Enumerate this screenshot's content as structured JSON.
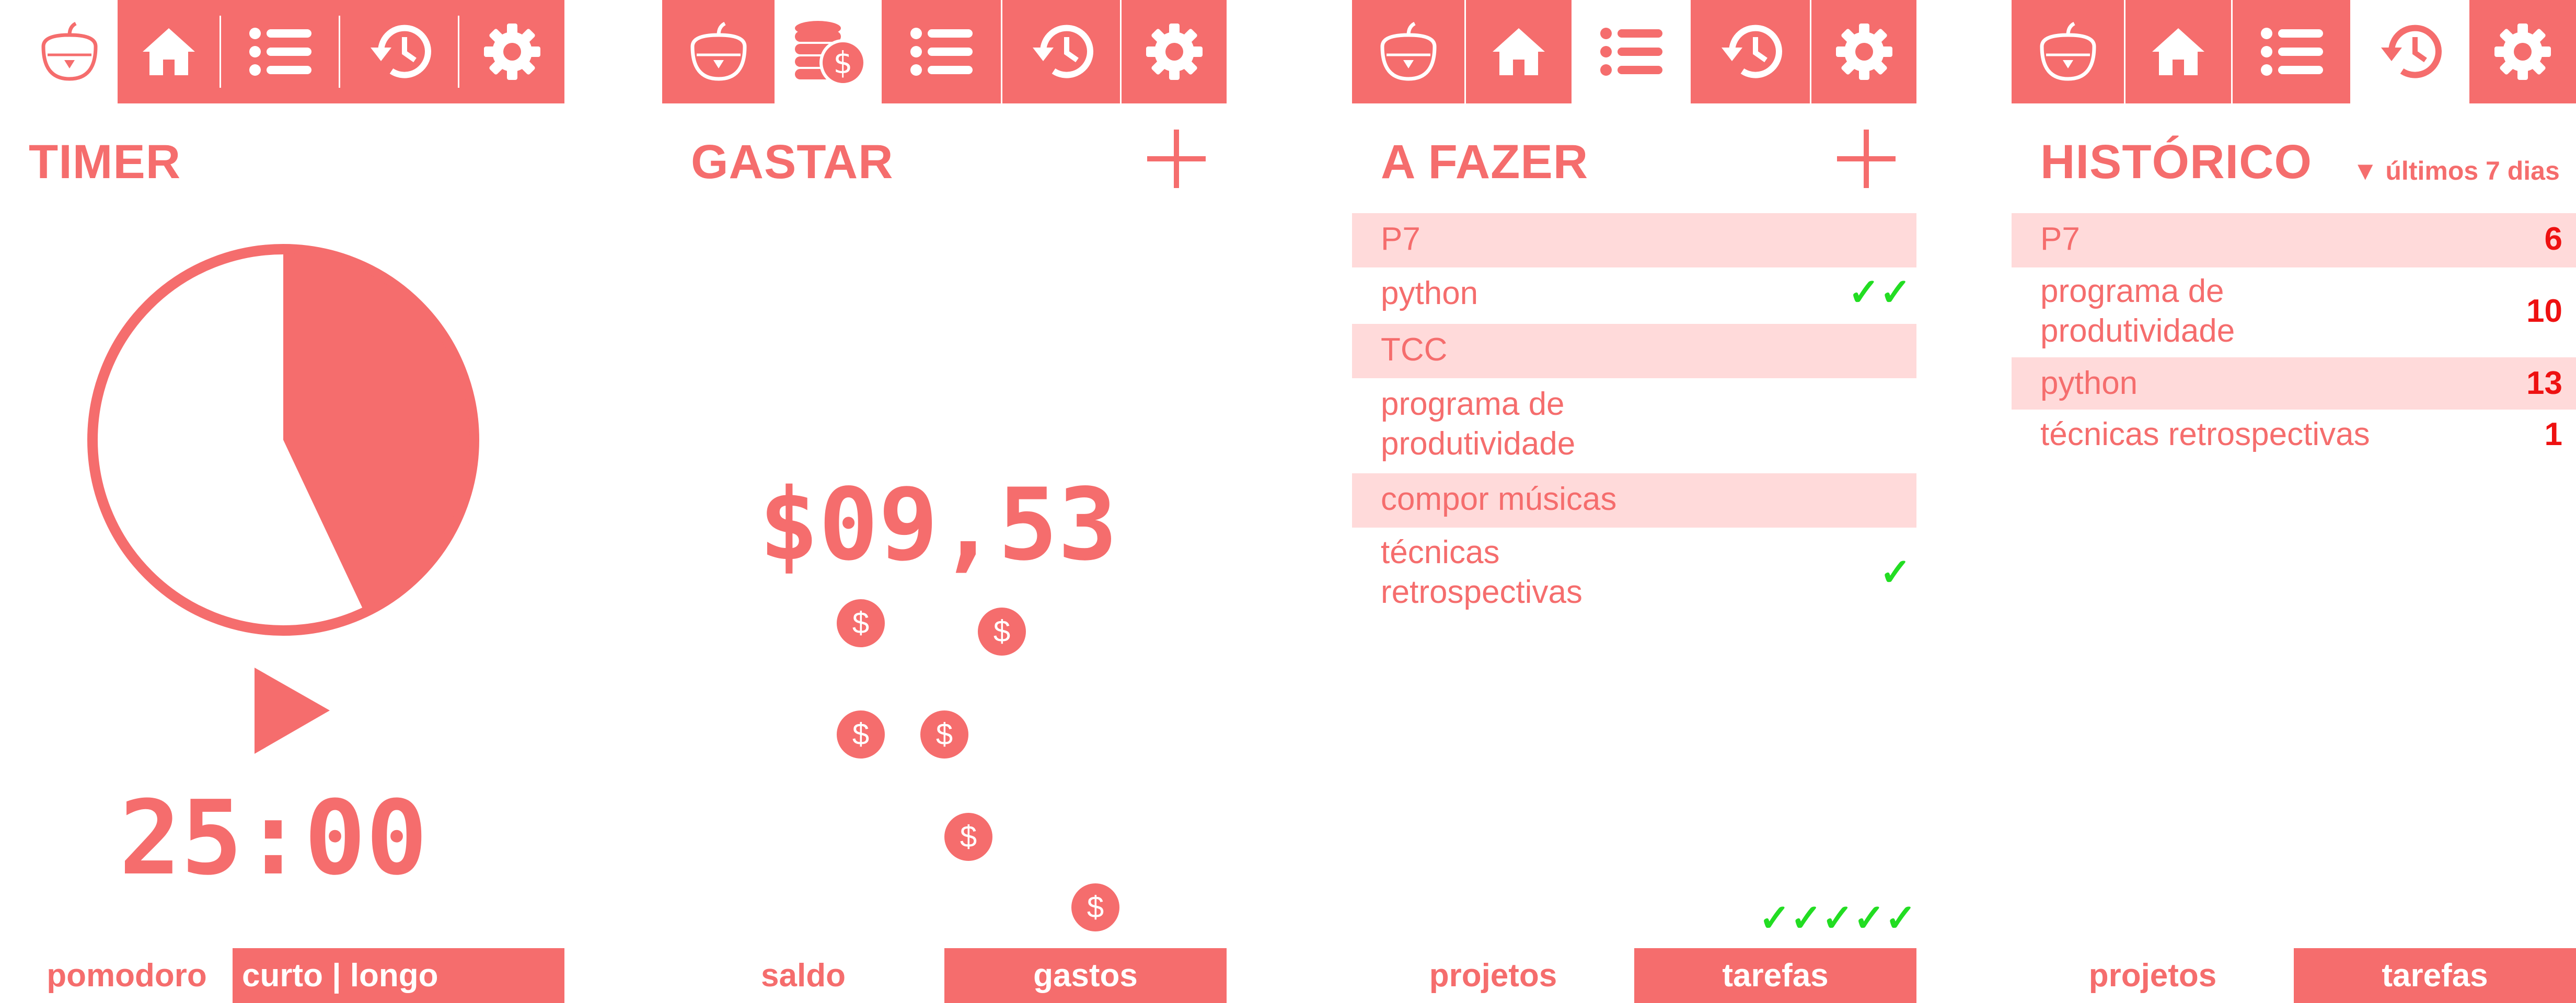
{
  "colors": {
    "accent": "#f56d6d",
    "row_shade": "#ffdada",
    "check": "#22dd22",
    "count": "#ee1111"
  },
  "timer_screen": {
    "tabs": [
      "tomato-icon",
      "home-icon",
      "list-icon",
      "history-icon",
      "gear-icon"
    ],
    "title": "TIMER",
    "progress_fraction": 0.43,
    "play_icon": "play-icon",
    "time": "25:00",
    "bottom": {
      "left": "pomodoro",
      "right": "curto | longo"
    }
  },
  "spend_screen": {
    "tabs": [
      "tomato-icon",
      "coins-icon",
      "list-icon",
      "history-icon",
      "gear-icon"
    ],
    "title": "GASTAR",
    "add_icon": "plus-icon",
    "balance": "$09,53",
    "coin_symbol": "$",
    "coin_count": 6,
    "bottom": {
      "left": "saldo",
      "right": "gastos"
    }
  },
  "todo_screen": {
    "tabs": [
      "tomato-icon",
      "home-icon",
      "list-icon",
      "history-icon",
      "gear-icon"
    ],
    "title": "A FAZER",
    "add_icon": "plus-icon",
    "items": [
      {
        "label": "P7",
        "checks": ""
      },
      {
        "label": "python",
        "checks": "✓✓"
      },
      {
        "label": "TCC",
        "checks": ""
      },
      {
        "label_line1": "programa de",
        "label_line2": "produtividade",
        "checks": ""
      },
      {
        "label": "compor músicas",
        "checks": ""
      },
      {
        "label_line1": "técnicas",
        "label_line2": "retrospectivas",
        "checks": "✓"
      }
    ],
    "completed_checks": "✓✓✓✓✓",
    "bottom": {
      "left": "projetos",
      "right": "tarefas"
    }
  },
  "history_screen": {
    "tabs": [
      "tomato-icon",
      "home-icon",
      "list-icon",
      "history-icon",
      "gear-icon"
    ],
    "title": "HISTÓRICO",
    "filter": "▼ últimos 7 dias",
    "items": [
      {
        "label": "P7",
        "count": "6"
      },
      {
        "label_line1": "programa de",
        "label_line2": "produtividade",
        "count": "10"
      },
      {
        "label": "python",
        "count": "13"
      },
      {
        "label": "técnicas retrospectivas",
        "count": "1"
      }
    ],
    "bottom": {
      "left": "projetos",
      "right": "tarefas"
    }
  }
}
